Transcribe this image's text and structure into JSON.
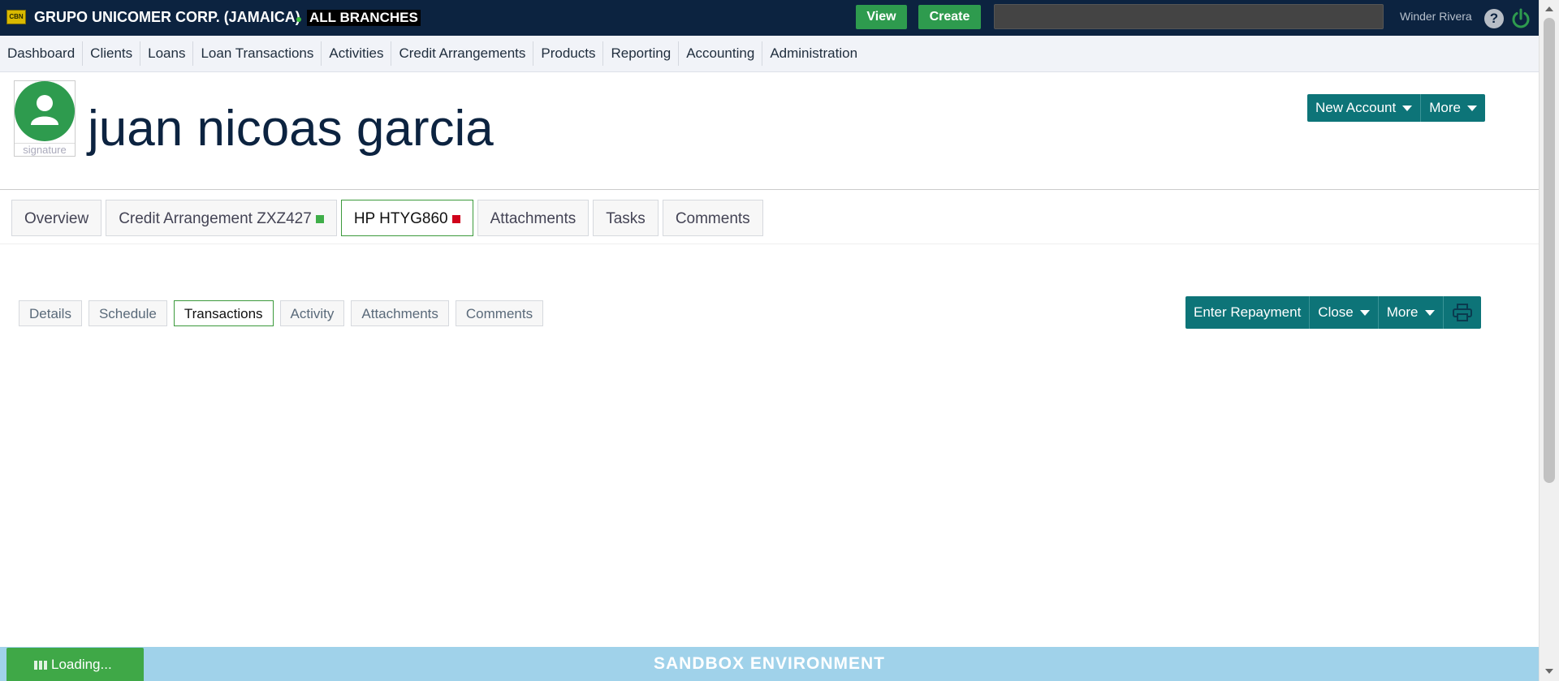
{
  "topbar": {
    "logo_text": "CBN",
    "company": "GRUPO UNICOMER CORP. (JAMAICA)",
    "branch": "ALL BRANCHES",
    "view_label": "View",
    "create_label": "Create",
    "search_value": "",
    "user_name": "Winder Rivera",
    "help_label": "?"
  },
  "nav": {
    "items": [
      "Dashboard",
      "Clients",
      "Loans",
      "Loan Transactions",
      "Activities",
      "Credit Arrangements",
      "Products",
      "Reporting",
      "Accounting",
      "Administration"
    ]
  },
  "client": {
    "name": "juan nicoas garcia",
    "signature_label": "signature",
    "new_account_label": "New Account",
    "more_label": "More"
  },
  "tabs": {
    "items": [
      "Overview",
      "Credit Arrangement ZXZ427",
      "HP HTYG860",
      "Attachments",
      "Tasks",
      "Comments"
    ],
    "active": "HP HTYG860",
    "credit_status_color": "#3fae49",
    "hp_status_color": "#d0021b"
  },
  "subtabs": {
    "items": [
      "Details",
      "Schedule",
      "Transactions",
      "Activity",
      "Attachments",
      "Comments"
    ],
    "active": "Transactions"
  },
  "actions": {
    "enter_repayment": "Enter Repayment",
    "close": "Close",
    "more": "More",
    "print_icon": "printer-icon"
  },
  "footer": {
    "environment": "SANDBOX ENVIRONMENT",
    "loading": "Loading..."
  },
  "colors": {
    "topbar": "#0c2340",
    "accent_teal": "#0d7478",
    "green": "#2e9b4e",
    "footer": "#a0d2ea"
  }
}
